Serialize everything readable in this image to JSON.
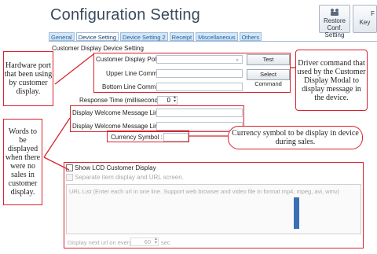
{
  "app": {
    "title": "Configuration Setting"
  },
  "toolbar": {
    "restore_label_1": "Restore Conf.",
    "restore_label_2": "Setting",
    "key_label_top": "F",
    "key_label": "Key"
  },
  "tabs": [
    {
      "label": "General",
      "active": false
    },
    {
      "label": "Device Setting",
      "active": true
    },
    {
      "label": "Device Setting 2",
      "active": false
    },
    {
      "label": "Receipt",
      "active": false
    },
    {
      "label": "Miscellaneous",
      "active": false
    },
    {
      "label": "Others",
      "active": false
    }
  ],
  "section": {
    "title": "Customer Display Device Setting"
  },
  "form": {
    "pole_label": "Customer Display Pole :",
    "pole_value": "",
    "upper_label": "Upper Line Command :",
    "upper_value": "",
    "bottom_label": "Bottom Line Command :",
    "bottom_value": "",
    "response_label": "Response Time (millisecond) :",
    "response_value": "0",
    "welcome1_label": "Display Welcome Message Line1 :",
    "welcome1_value": "",
    "welcome2_label": "Display Welcome Message Line2 :",
    "welcome2_value": "",
    "currency_label": "Currency Symbol :",
    "currency_value": ""
  },
  "buttons": {
    "test_label": "Test",
    "select_label": "Select Command"
  },
  "lcd": {
    "show_label": "Show LCD Customer Display",
    "separate_label": "Separate item display and URL screen.",
    "url_list_label": "URL List (Enter each url in one line. Support web browser and video file in format mp4, mpeg, avi, wmv)",
    "next_url_label": "Display next url on every",
    "next_url_value": "60",
    "next_url_unit": "sec"
  },
  "callouts": {
    "hardware": "Hardware port that been using by customer display.",
    "driver": "Driver command that used by the Customer Display Modal to display message in the device.",
    "words": "Words to be displayed when there were no sales in customer display.",
    "currency": "Currency symbol to be display in device during sales."
  },
  "colors": {
    "accent_red": "#d9232e",
    "tab_blue": "#1f5fa6",
    "title": "#3a4a5c",
    "scroll_blue": "#3b6fb6"
  }
}
